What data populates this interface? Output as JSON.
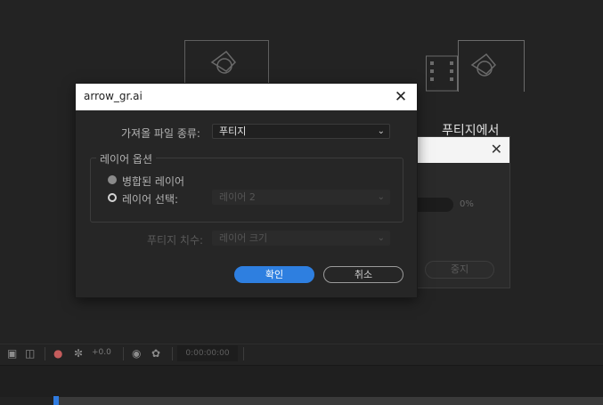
{
  "background": {
    "caption": "푸티지에서",
    "progress": {
      "percent_label": "0%",
      "percent": 0,
      "stop_label": "중지",
      "close_glyph": "✕"
    }
  },
  "dialog": {
    "title": "arrow_gr.ai",
    "close_glyph": "✕",
    "import_kind": {
      "label": "가져올 파일 종류:",
      "value": "푸티지"
    },
    "layer_options": {
      "group_label": "레이어 옵션",
      "merged_label": "병합된 레이어",
      "select_label": "레이어 선택:",
      "select_value": "레이어 2"
    },
    "footage_size": {
      "label": "푸티지 치수:",
      "value": "레이어 크기"
    },
    "ok_label": "확인",
    "cancel_label": "취소"
  },
  "timeline": {
    "offset": "+0.0",
    "timecode": "0:00:00:00"
  },
  "colors": {
    "accent": "#2e7fe0",
    "background": "#232323",
    "dialog_bg": "#262626"
  },
  "icons": [
    "chevron-down-icon",
    "close-icon",
    "camera-icon",
    "color-wheel-icon",
    "monitor-icon"
  ]
}
